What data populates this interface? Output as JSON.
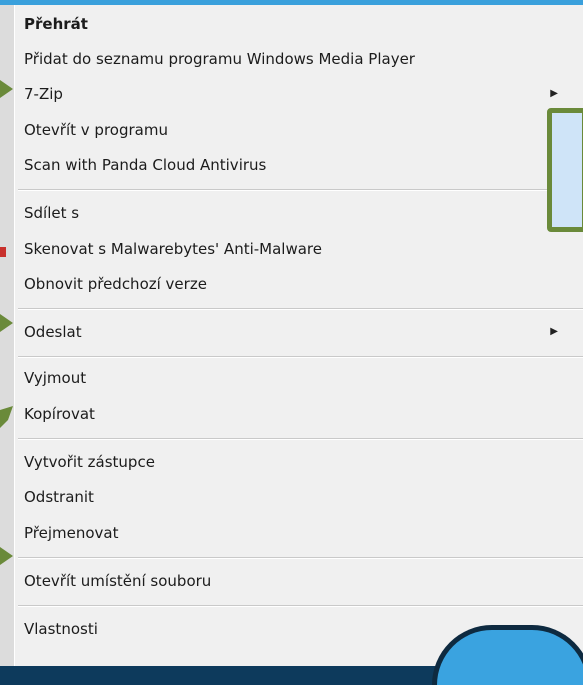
{
  "menu": {
    "items": [
      {
        "label": "Přehrát",
        "bold": true,
        "submenu": false
      },
      {
        "label": "Přidat do seznamu programu Windows Media Player",
        "bold": false,
        "submenu": false
      },
      {
        "label": "7-Zip",
        "bold": false,
        "submenu": true
      },
      {
        "label": "Otevřít v programu",
        "bold": false,
        "submenu": false
      },
      {
        "label": "Scan with Panda Cloud Antivirus",
        "bold": false,
        "submenu": false
      },
      {
        "label": "Sdílet s",
        "bold": false,
        "submenu": false
      },
      {
        "label": "Skenovat s Malwarebytes' Anti-Malware",
        "bold": false,
        "submenu": false
      },
      {
        "label": "Obnovit předchozí verze",
        "bold": false,
        "submenu": false
      },
      {
        "label": "Odeslat",
        "bold": false,
        "submenu": true
      },
      {
        "label": "Vyjmout",
        "bold": false,
        "submenu": false
      },
      {
        "label": "Kopírovat",
        "bold": false,
        "submenu": false
      },
      {
        "label": "Vytvořit zástupce",
        "bold": false,
        "submenu": false
      },
      {
        "label": "Odstranit",
        "bold": false,
        "submenu": false
      },
      {
        "label": "Přejmenovat",
        "bold": false,
        "submenu": false
      },
      {
        "label": "Otevřít umístění souboru",
        "bold": false,
        "submenu": false
      },
      {
        "label": "Vlastnosti",
        "bold": false,
        "submenu": false
      }
    ],
    "arrow_glyph": "▶"
  },
  "colors": {
    "menu_bg": "#f0f0f0",
    "accent_blue": "#3aa0dc",
    "pointer_green": "#6a8a3a"
  },
  "icons": [
    "chevron-right-icon",
    "malwarebytes-icon",
    "pointer-arrow-icon"
  ]
}
